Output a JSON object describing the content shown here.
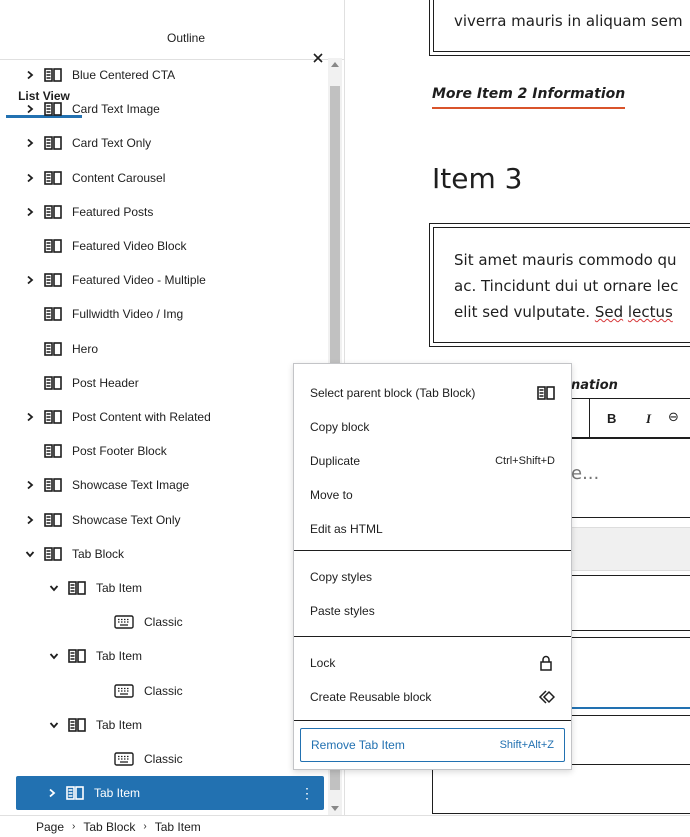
{
  "panel": {
    "tabs": [
      {
        "label": "List View"
      },
      {
        "label": "Outline"
      }
    ],
    "close_glyph": "×",
    "items": [
      {
        "label": "Blue Centered CTA",
        "expander": "collapsed",
        "icon": "block-icon"
      },
      {
        "label": "Card Text Image",
        "expander": "collapsed",
        "icon": "block-icon"
      },
      {
        "label": "Card Text Only",
        "expander": "collapsed",
        "icon": "block-icon"
      },
      {
        "label": "Content Carousel",
        "expander": "collapsed",
        "icon": "block-icon"
      },
      {
        "label": "Featured Posts",
        "expander": "collapsed",
        "icon": "block-icon"
      },
      {
        "label": "Featured Video Block",
        "expander": "none",
        "icon": "block-icon"
      },
      {
        "label": "Featured Video - Multiple",
        "expander": "collapsed",
        "icon": "block-icon"
      },
      {
        "label": "Fullwidth Video / Img",
        "expander": "none",
        "icon": "block-icon"
      },
      {
        "label": "Hero",
        "expander": "none",
        "icon": "block-icon"
      },
      {
        "label": "Post Header",
        "expander": "none",
        "icon": "block-icon"
      },
      {
        "label": "Post Content with Related",
        "expander": "collapsed",
        "icon": "block-icon"
      },
      {
        "label": "Post Footer Block",
        "expander": "none",
        "icon": "block-icon"
      },
      {
        "label": "Showcase Text Image",
        "expander": "collapsed",
        "icon": "block-icon"
      },
      {
        "label": "Showcase Text Only",
        "expander": "collapsed",
        "icon": "block-icon"
      },
      {
        "label": "Tab Block",
        "expander": "expanded",
        "icon": "block-icon"
      },
      {
        "label": "Tab Item",
        "expander": "expanded",
        "icon": "block-icon"
      },
      {
        "label": "Classic",
        "expander": "none",
        "icon": "keyboard-icon"
      },
      {
        "label": "Tab Item",
        "expander": "expanded",
        "icon": "block-icon"
      },
      {
        "label": "Classic",
        "expander": "none",
        "icon": "keyboard-icon"
      },
      {
        "label": "Tab Item",
        "expander": "expanded",
        "icon": "block-icon"
      },
      {
        "label": "Classic",
        "expander": "none",
        "icon": "keyboard-icon"
      },
      {
        "label": "Tab Item",
        "expander": "collapsed",
        "icon": "block-icon",
        "selected": true,
        "more": "⋮"
      }
    ]
  },
  "breadcrumb": {
    "items": [
      "Page",
      "Tab Block",
      "Tab Item"
    ],
    "separator": "›"
  },
  "canvas": {
    "top_box_text": "viverra mauris in aliquam sem",
    "more_info": "More Item 2 Information",
    "heading": "Item 3",
    "para_line1": "Sit amet mauris commodo qu",
    "para_line2": "ac. Tincidunt dui ut ornare lec",
    "para_line3_a": "elit sed vulputate. ",
    "para_line3_b": "Sed",
    "para_line3_c": " ",
    "para_line3_d": "lectus",
    "partial_heading": "nation",
    "toolbar_bold": "B",
    "toolbar_italic": "I",
    "toolbar_link": "⊖",
    "partial_placeholder": "e..."
  },
  "context_menu": {
    "items": [
      {
        "label": "Select parent block (Tab Block)",
        "icon": "block-icon"
      },
      {
        "label": "Copy block"
      },
      {
        "label": "Duplicate",
        "shortcut": "Ctrl+Shift+D"
      },
      {
        "label": "Move to"
      },
      {
        "label": "Edit as HTML"
      },
      {
        "label": "Copy styles"
      },
      {
        "label": "Paste styles"
      },
      {
        "label": "Lock",
        "icon": "lock-icon"
      },
      {
        "label": "Create Reusable block",
        "icon": "reusable-icon"
      },
      {
        "label": "Remove Tab Item",
        "shortcut": "Shift+Alt+Z"
      }
    ]
  },
  "colors": {
    "accent": "#2271b1",
    "underline": "#d9542b",
    "text": "#1e1e1e"
  }
}
